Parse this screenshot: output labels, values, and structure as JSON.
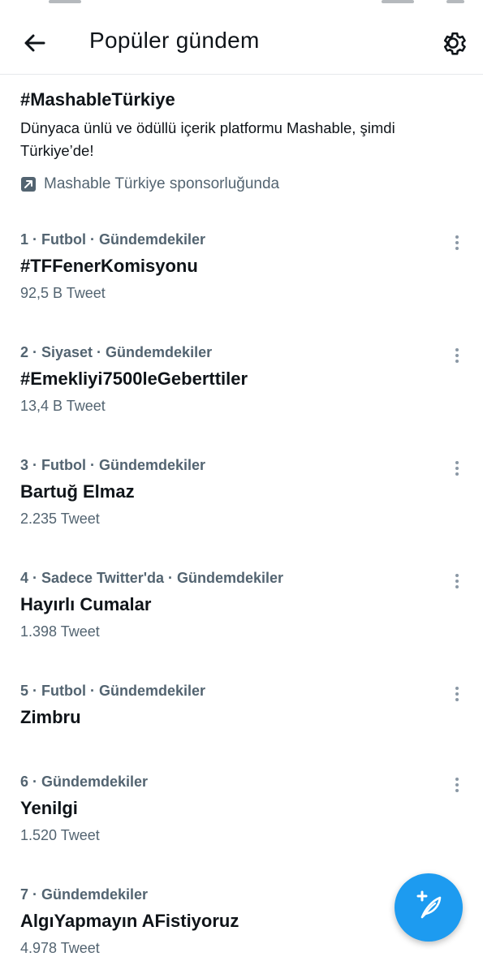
{
  "header": {
    "title": "Popüler gündem",
    "back_icon": "arrow-left-icon",
    "settings_icon": "gear-icon"
  },
  "promo": {
    "hashtag": "#MashableTürkiye",
    "description": "Dünyaca ünlü ve ödüllü içerik platformu Mashable, şimdi Türkiye’de!",
    "sponsor_text": "Mashable Türkiye sponsorluğunda",
    "sponsor_icon": "promoted-arrow-icon"
  },
  "trends": [
    {
      "meta": "1 · Futbol · Gündemdekiler",
      "name": "#TFFenerKomisyonu",
      "count": "92,5 B Tweet"
    },
    {
      "meta": "2 · Siyaset · Gündemdekiler",
      "name": "#Emekliyi7500leGeberttiler",
      "count": "13,4 B Tweet"
    },
    {
      "meta": "3 · Futbol · Gündemdekiler",
      "name": "Bartuğ Elmaz",
      "count": "2.235 Tweet"
    },
    {
      "meta": "4 · Sadece Twitter'da · Gündemdekiler",
      "name": "Hayırlı Cumalar",
      "count": "1.398 Tweet"
    },
    {
      "meta": "5 · Futbol · Gündemdekiler",
      "name": "Zimbru",
      "count": ""
    },
    {
      "meta": "6 · Gündemdekiler",
      "name": "Yenilgi",
      "count": "1.520 Tweet"
    },
    {
      "meta": "7 · Gündemdekiler",
      "name": "AlgıYapmayın AFistiyoruz",
      "count": "4.978 Tweet"
    }
  ],
  "fab": {
    "icon": "compose-tweet-icon"
  },
  "colors": {
    "accent": "#1d9bf0",
    "secondary_text": "#536471",
    "primary_text": "#0f1419"
  }
}
